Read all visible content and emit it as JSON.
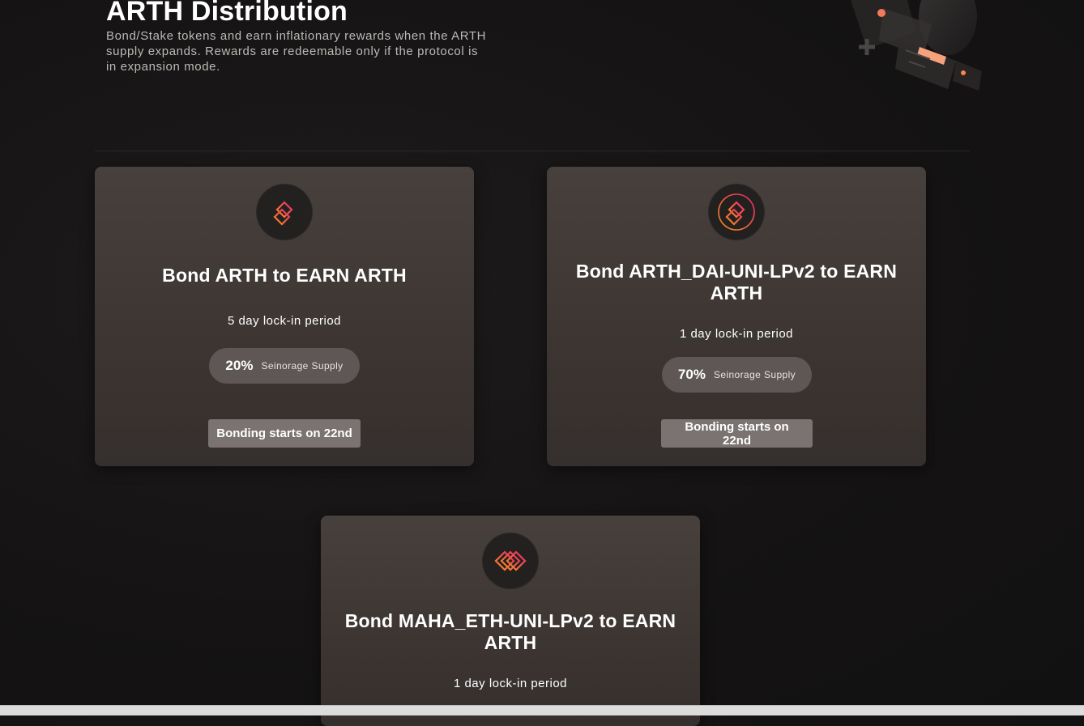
{
  "header": {
    "title": "ARTH Distribution",
    "description": "Bond/Stake tokens and earn inflationary rewards when the ARTH supply expands. Rewards are redeemable only if the protocol is in expansion mode."
  },
  "cards": [
    {
      "token_icon": "arth-token-icon",
      "title": "Bond ARTH to EARN ARTH",
      "lock_period": "5 day lock-in period",
      "supply_percent": "20%",
      "supply_label": "Seinorage Supply",
      "button_label": "Bonding starts on 22nd"
    },
    {
      "token_icon": "arth-dai-lp-token-icon",
      "title": "Bond ARTH_DAI-UNI-LPv2 to EARN ARTH",
      "lock_period": "1 day lock-in period",
      "supply_percent": "70%",
      "supply_label": "Seinorage Supply",
      "button_label": "Bonding starts on 22nd"
    },
    {
      "token_icon": "maha-eth-lp-token-icon",
      "title": "Bond MAHA_ETH-UNI-LPv2 to EARN ARTH",
      "lock_period": "1 day lock-in period"
    }
  ],
  "colors": {
    "background": "#151313",
    "card": "#433c38",
    "pill": "#5f5756",
    "button": "#7a7371",
    "accent_orange": "#f7931e",
    "accent_pink": "#e8246a"
  }
}
